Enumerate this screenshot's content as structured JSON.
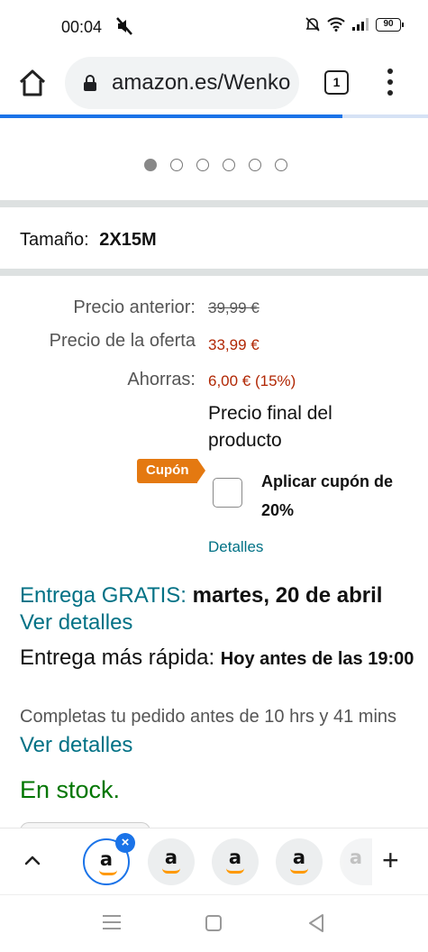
{
  "status_bar": {
    "time": "00:04",
    "battery": "90",
    "icons": [
      "mute-icon",
      "alarm-off-icon",
      "wifi-icon",
      "signal-icon",
      "battery-icon"
    ]
  },
  "browser": {
    "url": "amazon.es/Wenko",
    "tab_count": "1",
    "load_progress": 0.8,
    "accent_color": "#1a73e8"
  },
  "carousel": {
    "dot_count": 6,
    "active_index": 0
  },
  "product": {
    "size_label": "Tamaño:",
    "size_value": "2X15M"
  },
  "pricing": {
    "previous_label": "Precio anterior:",
    "previous_value": "39,99 €",
    "offer_label": "Precio de la oferta",
    "offer_value": "33,99 €",
    "savings_label": "Ahorras:",
    "savings_value": "6,00 € (15%)",
    "final_note": "Precio final del producto"
  },
  "coupon": {
    "badge": "Cupón",
    "checkbox_label": "Aplicar cupón de 20%",
    "details_link": "Detalles"
  },
  "delivery": {
    "free_label": "Entrega GRATIS:",
    "free_date": "martes, 20 de abril",
    "free_details_link": "Ver detalles",
    "fast_label": "Entrega más rápida:",
    "fast_date": "Hoy antes de las 19:00",
    "cutoff_text": "Completas tu pedido antes de 10 hrs y 41 mins",
    "cutoff_link": "Ver detalles"
  },
  "stock": {
    "status": "En stock."
  },
  "tab_strip": {
    "tab_letter": "a",
    "close_glyph": "×",
    "new_tab_glyph": "+"
  },
  "colors": {
    "price_red": "#b12704",
    "link_teal": "#007185",
    "stock_green": "#007600",
    "coupon_orange": "#e47911"
  }
}
